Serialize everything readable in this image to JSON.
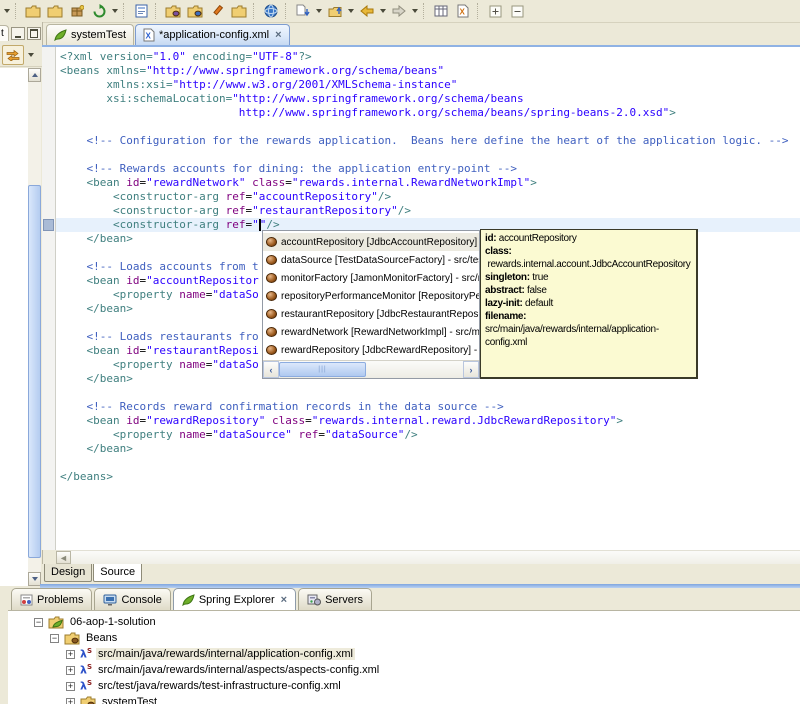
{
  "toolbar": {
    "items": [
      {
        "type": "caret",
        "name": "toolbar-dropdown"
      },
      {
        "type": "sep"
      },
      {
        "type": "button",
        "name": "new-wizard-button",
        "icon": "new-folder-star-icon"
      },
      {
        "type": "button",
        "name": "new-wizard-alt-button",
        "icon": "new-folder-star-icon"
      },
      {
        "type": "button",
        "name": "new-package-button",
        "icon": "package-star-icon"
      },
      {
        "type": "button",
        "name": "refresh-button",
        "icon": "refresh-icon"
      },
      {
        "type": "caret",
        "name": "refresh-dropdown"
      },
      {
        "type": "sep"
      },
      {
        "type": "button",
        "name": "form-editor-button",
        "icon": "form-icon"
      },
      {
        "type": "sep"
      },
      {
        "type": "button",
        "name": "open-type-button",
        "icon": "folder-purple-icon"
      },
      {
        "type": "button",
        "name": "open-resource-button",
        "icon": "folder-blue-icon"
      },
      {
        "type": "button",
        "name": "launch-button",
        "icon": "pencil-icon"
      },
      {
        "type": "button",
        "name": "open-folder-button",
        "icon": "folder-icon"
      },
      {
        "type": "sep"
      },
      {
        "type": "button",
        "name": "web-browser-button",
        "icon": "globe-icon"
      },
      {
        "type": "sep"
      },
      {
        "type": "button",
        "name": "last-edit-location-button",
        "icon": "doc-down-arrow-icon"
      },
      {
        "type": "caret",
        "name": "last-edit-dropdown"
      },
      {
        "type": "button",
        "name": "go-up-button",
        "icon": "folder-up-arrow-icon"
      },
      {
        "type": "caret",
        "name": "go-up-dropdown"
      },
      {
        "type": "button",
        "name": "back-button",
        "icon": "back-arrow-icon"
      },
      {
        "type": "caret",
        "name": "back-dropdown"
      },
      {
        "type": "button",
        "name": "forward-button",
        "icon": "forward-arrow-icon"
      },
      {
        "type": "caret",
        "name": "forward-dropdown"
      },
      {
        "type": "sep"
      },
      {
        "type": "button",
        "name": "grid-view-button",
        "icon": "grid-icon"
      },
      {
        "type": "button",
        "name": "xml-doc-button",
        "icon": "xml-file-orange-icon"
      },
      {
        "type": "sep"
      },
      {
        "type": "button",
        "name": "expand-all-button",
        "icon": "expand-all-icon"
      },
      {
        "type": "button",
        "name": "collapse-all-button",
        "icon": "collapse-all-icon"
      }
    ]
  },
  "left_panel": {
    "tab_label": "t"
  },
  "editor": {
    "tabs": [
      {
        "label": "systemTest",
        "icon": "spring-leaf-icon",
        "active": false
      },
      {
        "label": "*application-config.xml",
        "icon": "xml-file-icon",
        "active": true,
        "close_label": "×"
      }
    ],
    "current_line_index": 12,
    "colors": {
      "tag": "#3F7F7F",
      "attr": "#7F007F",
      "value": "#2A00FF",
      "comment": "#3F5FBF",
      "text": "#000000"
    },
    "lines": [
      [
        [
          "t",
          "<?xml version="
        ],
        [
          "v",
          "\"1.0\""
        ],
        [
          "t",
          " encoding="
        ],
        [
          "v",
          "\"UTF-8\""
        ],
        [
          "t",
          "?>"
        ]
      ],
      [
        [
          "t",
          "<beans xmlns="
        ],
        [
          "v",
          "\"http://www.springframework.org/schema/beans\""
        ]
      ],
      [
        [
          "t",
          "       xmlns:xsi="
        ],
        [
          "v",
          "\"http://www.w3.org/2001/XMLSchema-instance\""
        ]
      ],
      [
        [
          "t",
          "       xsi:schemaLocation="
        ],
        [
          "v",
          "\"http://www.springframework.org/schema/beans"
        ]
      ],
      [
        [
          "v",
          "                           http://www.springframework.org/schema/beans/spring-beans-2.0.xsd\""
        ],
        [
          "t",
          ">"
        ]
      ],
      [],
      [
        [
          "c",
          "    <!-- Configuration for the rewards application.  Beans here define the heart of the application logic. -->"
        ]
      ],
      [],
      [
        [
          "c",
          "    <!-- Rewards accounts for dining: the application entry-point -->"
        ]
      ],
      [
        [
          "t",
          "    <bean "
        ],
        [
          "a",
          "id"
        ],
        [
          "x",
          "="
        ],
        [
          "v",
          "\"rewardNetwork\""
        ],
        [
          "t",
          " "
        ],
        [
          "a",
          "class"
        ],
        [
          "x",
          "="
        ],
        [
          "v",
          "\"rewards.internal.RewardNetworkImpl\""
        ],
        [
          "t",
          ">"
        ]
      ],
      [
        [
          "t",
          "        <constructor-arg "
        ],
        [
          "a",
          "ref"
        ],
        [
          "x",
          "="
        ],
        [
          "v",
          "\"accountRepository\""
        ],
        [
          "t",
          "/>"
        ]
      ],
      [
        [
          "t",
          "        <constructor-arg "
        ],
        [
          "a",
          "ref"
        ],
        [
          "x",
          "="
        ],
        [
          "v",
          "\"restaurantRepository\""
        ],
        [
          "t",
          "/>"
        ]
      ],
      [
        [
          "t",
          "        <constructor-arg "
        ],
        [
          "a",
          "ref"
        ],
        [
          "x",
          "="
        ],
        [
          "v",
          "\""
        ],
        [
          "cur",
          ""
        ],
        [
          "v",
          "\""
        ],
        [
          "t",
          "/>"
        ]
      ],
      [
        [
          "t",
          "    </bean>"
        ]
      ],
      [],
      [
        [
          "c",
          "    <!-- Loads accounts from t"
        ]
      ],
      [
        [
          "t",
          "    <bean "
        ],
        [
          "a",
          "id"
        ],
        [
          "x",
          "="
        ],
        [
          "v",
          "\"accountRepositor"
        ]
      ],
      [
        [
          "t",
          "        <property "
        ],
        [
          "a",
          "name"
        ],
        [
          "x",
          "="
        ],
        [
          "v",
          "\"dataSo"
        ]
      ],
      [
        [
          "t",
          "    </bean>"
        ]
      ],
      [],
      [
        [
          "c",
          "    <!-- Loads restaurants fro"
        ]
      ],
      [
        [
          "t",
          "    <bean "
        ],
        [
          "a",
          "id"
        ],
        [
          "x",
          "="
        ],
        [
          "v",
          "\"restaurantReposi"
        ]
      ],
      [
        [
          "t",
          "        <property "
        ],
        [
          "a",
          "name"
        ],
        [
          "x",
          "="
        ],
        [
          "v",
          "\"dataSo"
        ]
      ],
      [
        [
          "t",
          "    </bean>"
        ]
      ],
      [],
      [
        [
          "c",
          "    <!-- Records reward confirmation records in the data source -->"
        ]
      ],
      [
        [
          "t",
          "    <bean "
        ],
        [
          "a",
          "id"
        ],
        [
          "x",
          "="
        ],
        [
          "v",
          "\"rewardRepository\""
        ],
        [
          "t",
          " "
        ],
        [
          "a",
          "class"
        ],
        [
          "x",
          "="
        ],
        [
          "v",
          "\"rewards.internal.reward.JdbcRewardRepository\""
        ],
        [
          "t",
          ">"
        ]
      ],
      [
        [
          "t",
          "        <property "
        ],
        [
          "a",
          "name"
        ],
        [
          "x",
          "="
        ],
        [
          "v",
          "\"dataSource\""
        ],
        [
          "t",
          " "
        ],
        [
          "a",
          "ref"
        ],
        [
          "x",
          "="
        ],
        [
          "v",
          "\"dataSource\""
        ],
        [
          "t",
          "/>"
        ]
      ],
      [
        [
          "t",
          "    </bean>"
        ]
      ],
      [],
      [
        [
          "t",
          "</beans>"
        ]
      ]
    ]
  },
  "completion_popup": {
    "selected_index": 0,
    "items": [
      "accountRepository [JdbcAccountRepository] - src/main/ja",
      "dataSource [TestDataSourceFactory] - src/test/ja",
      "monitorFactory [JamonMonitorFactory] - src/main",
      "repositoryPerformanceMonitor [RepositoryPerfor",
      "restaurantRepository [JdbcRestaurantRepository]",
      "rewardNetwork [RewardNetworkImpl] - src/main/j",
      "rewardRepository [JdbcRewardRepository] - src/r"
    ]
  },
  "bean_tooltip": {
    "fields": [
      {
        "label": "id:",
        "value": "accountRepository",
        "block": false
      },
      {
        "label": "class:",
        "value": "rewards.internal.account.JdbcAccountRepository",
        "block": true
      },
      {
        "label": "singleton:",
        "value": "true",
        "block": false
      },
      {
        "label": "abstract:",
        "value": "false",
        "block": false
      },
      {
        "label": "lazy-init:",
        "value": "default",
        "block": false
      },
      {
        "label": "filename:",
        "value": "src/main/java/rewards/internal/application-config.xml",
        "block": false
      }
    ]
  },
  "editor_bottom_tabs": [
    {
      "label": "Design",
      "active": false
    },
    {
      "label": "Source",
      "active": true
    }
  ],
  "bottom_panel": {
    "tabs": [
      {
        "label": "Problems",
        "icon": "problems-icon",
        "active": false
      },
      {
        "label": "Console",
        "icon": "console-icon",
        "active": false
      },
      {
        "label": "Spring Explorer",
        "icon": "spring-leaf-icon",
        "active": true,
        "close_label": "×"
      },
      {
        "label": "Servers",
        "icon": "servers-icon",
        "active": false
      }
    ],
    "tree": [
      {
        "depth": 0,
        "expander": "−",
        "icon": "spring-project-icon",
        "label": "06-aop-1-solution",
        "selected": false
      },
      {
        "depth": 1,
        "expander": "−",
        "icon": "beans-folder-icon",
        "label": "Beans",
        "selected": false
      },
      {
        "depth": 2,
        "expander": "+",
        "icon": "spring-config-icon",
        "label": "src/main/java/rewards/internal/application-config.xml",
        "selected": true
      },
      {
        "depth": 2,
        "expander": "+",
        "icon": "spring-config-icon",
        "label": "src/main/java/rewards/internal/aspects/aspects-config.xml",
        "selected": false
      },
      {
        "depth": 2,
        "expander": "+",
        "icon": "spring-config-icon",
        "label": "src/test/java/rewards/test-infrastructure-config.xml",
        "selected": false
      },
      {
        "depth": 2,
        "expander": "+",
        "icon": "config-set-icon",
        "label": "systemTest",
        "selected": false
      }
    ]
  }
}
